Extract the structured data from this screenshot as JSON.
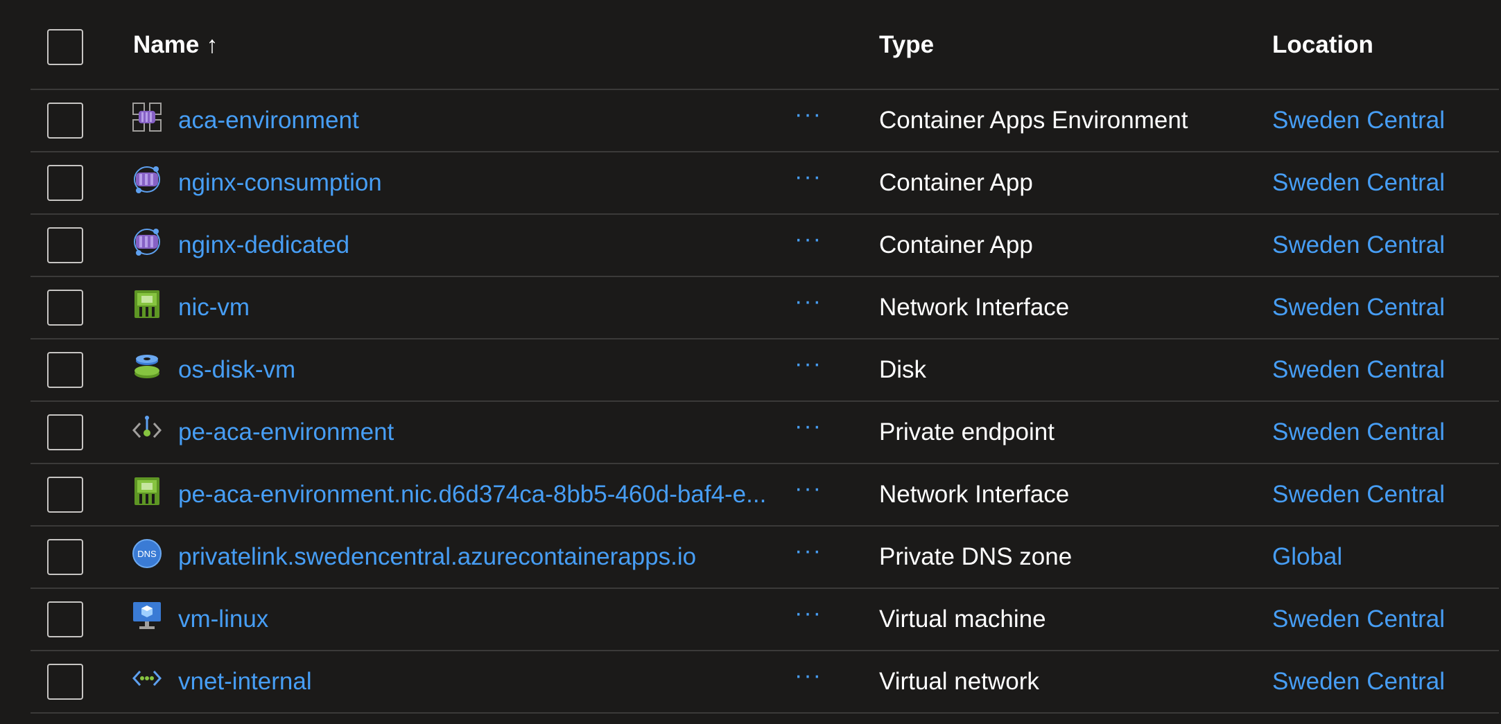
{
  "header": {
    "name_label": "Name",
    "sort_indicator": "↑",
    "type_label": "Type",
    "location_label": "Location"
  },
  "more_label": "···",
  "rows": [
    {
      "name": "aca-environment",
      "type": "Container Apps Environment",
      "location": "Sweden Central",
      "icon": "container-apps-environment-icon"
    },
    {
      "name": "nginx-consumption",
      "type": "Container App",
      "location": "Sweden Central",
      "icon": "container-app-icon"
    },
    {
      "name": "nginx-dedicated",
      "type": "Container App",
      "location": "Sweden Central",
      "icon": "container-app-icon"
    },
    {
      "name": "nic-vm",
      "type": "Network Interface",
      "location": "Sweden Central",
      "icon": "network-interface-icon"
    },
    {
      "name": "os-disk-vm",
      "type": "Disk",
      "location": "Sweden Central",
      "icon": "disk-icon"
    },
    {
      "name": "pe-aca-environment",
      "type": "Private endpoint",
      "location": "Sweden Central",
      "icon": "private-endpoint-icon"
    },
    {
      "name": "pe-aca-environment.nic.d6d374ca-8bb5-460d-baf4-e...",
      "type": "Network Interface",
      "location": "Sweden Central",
      "icon": "network-interface-icon"
    },
    {
      "name": "privatelink.swedencentral.azurecontainerapps.io",
      "type": "Private DNS zone",
      "location": "Global",
      "icon": "dns-zone-icon",
      "icon_text": "DNS"
    },
    {
      "name": "vm-linux",
      "type": "Virtual machine",
      "location": "Sweden Central",
      "icon": "virtual-machine-icon"
    },
    {
      "name": "vnet-internal",
      "type": "Virtual network",
      "location": "Sweden Central",
      "icon": "virtual-network-icon"
    }
  ],
  "colors": {
    "background": "#1b1a19",
    "link": "#479ef5",
    "divider": "#3b3a39"
  }
}
